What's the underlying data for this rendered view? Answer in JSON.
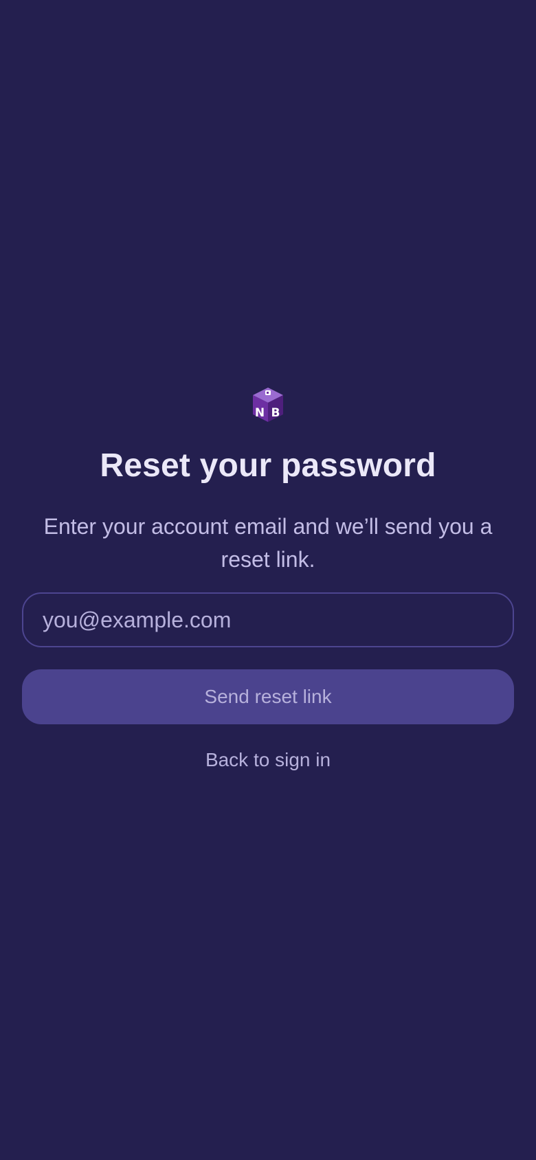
{
  "logo": {
    "icon": "nb-cube-logo-icon",
    "letters": "NB",
    "colors": {
      "top": "#9a6bd0",
      "left": "#6d2fa3",
      "right": "#4e1f7c",
      "letter": "#ffffff"
    }
  },
  "page": {
    "title": "Reset your password",
    "subtitle": "Enter your account email and we’ll send you a reset link."
  },
  "form": {
    "email_value": "",
    "email_placeholder": "you@example.com",
    "submit_label": "Send reset link"
  },
  "footer": {
    "back_label": "Back to sign in"
  },
  "colors": {
    "background": "#241f4f",
    "title": "#ebe8f8",
    "subtitle": "#c3bde6",
    "input_border": "#4d4590",
    "button_bg": "#4b438e",
    "button_text": "#b7b1dc"
  }
}
